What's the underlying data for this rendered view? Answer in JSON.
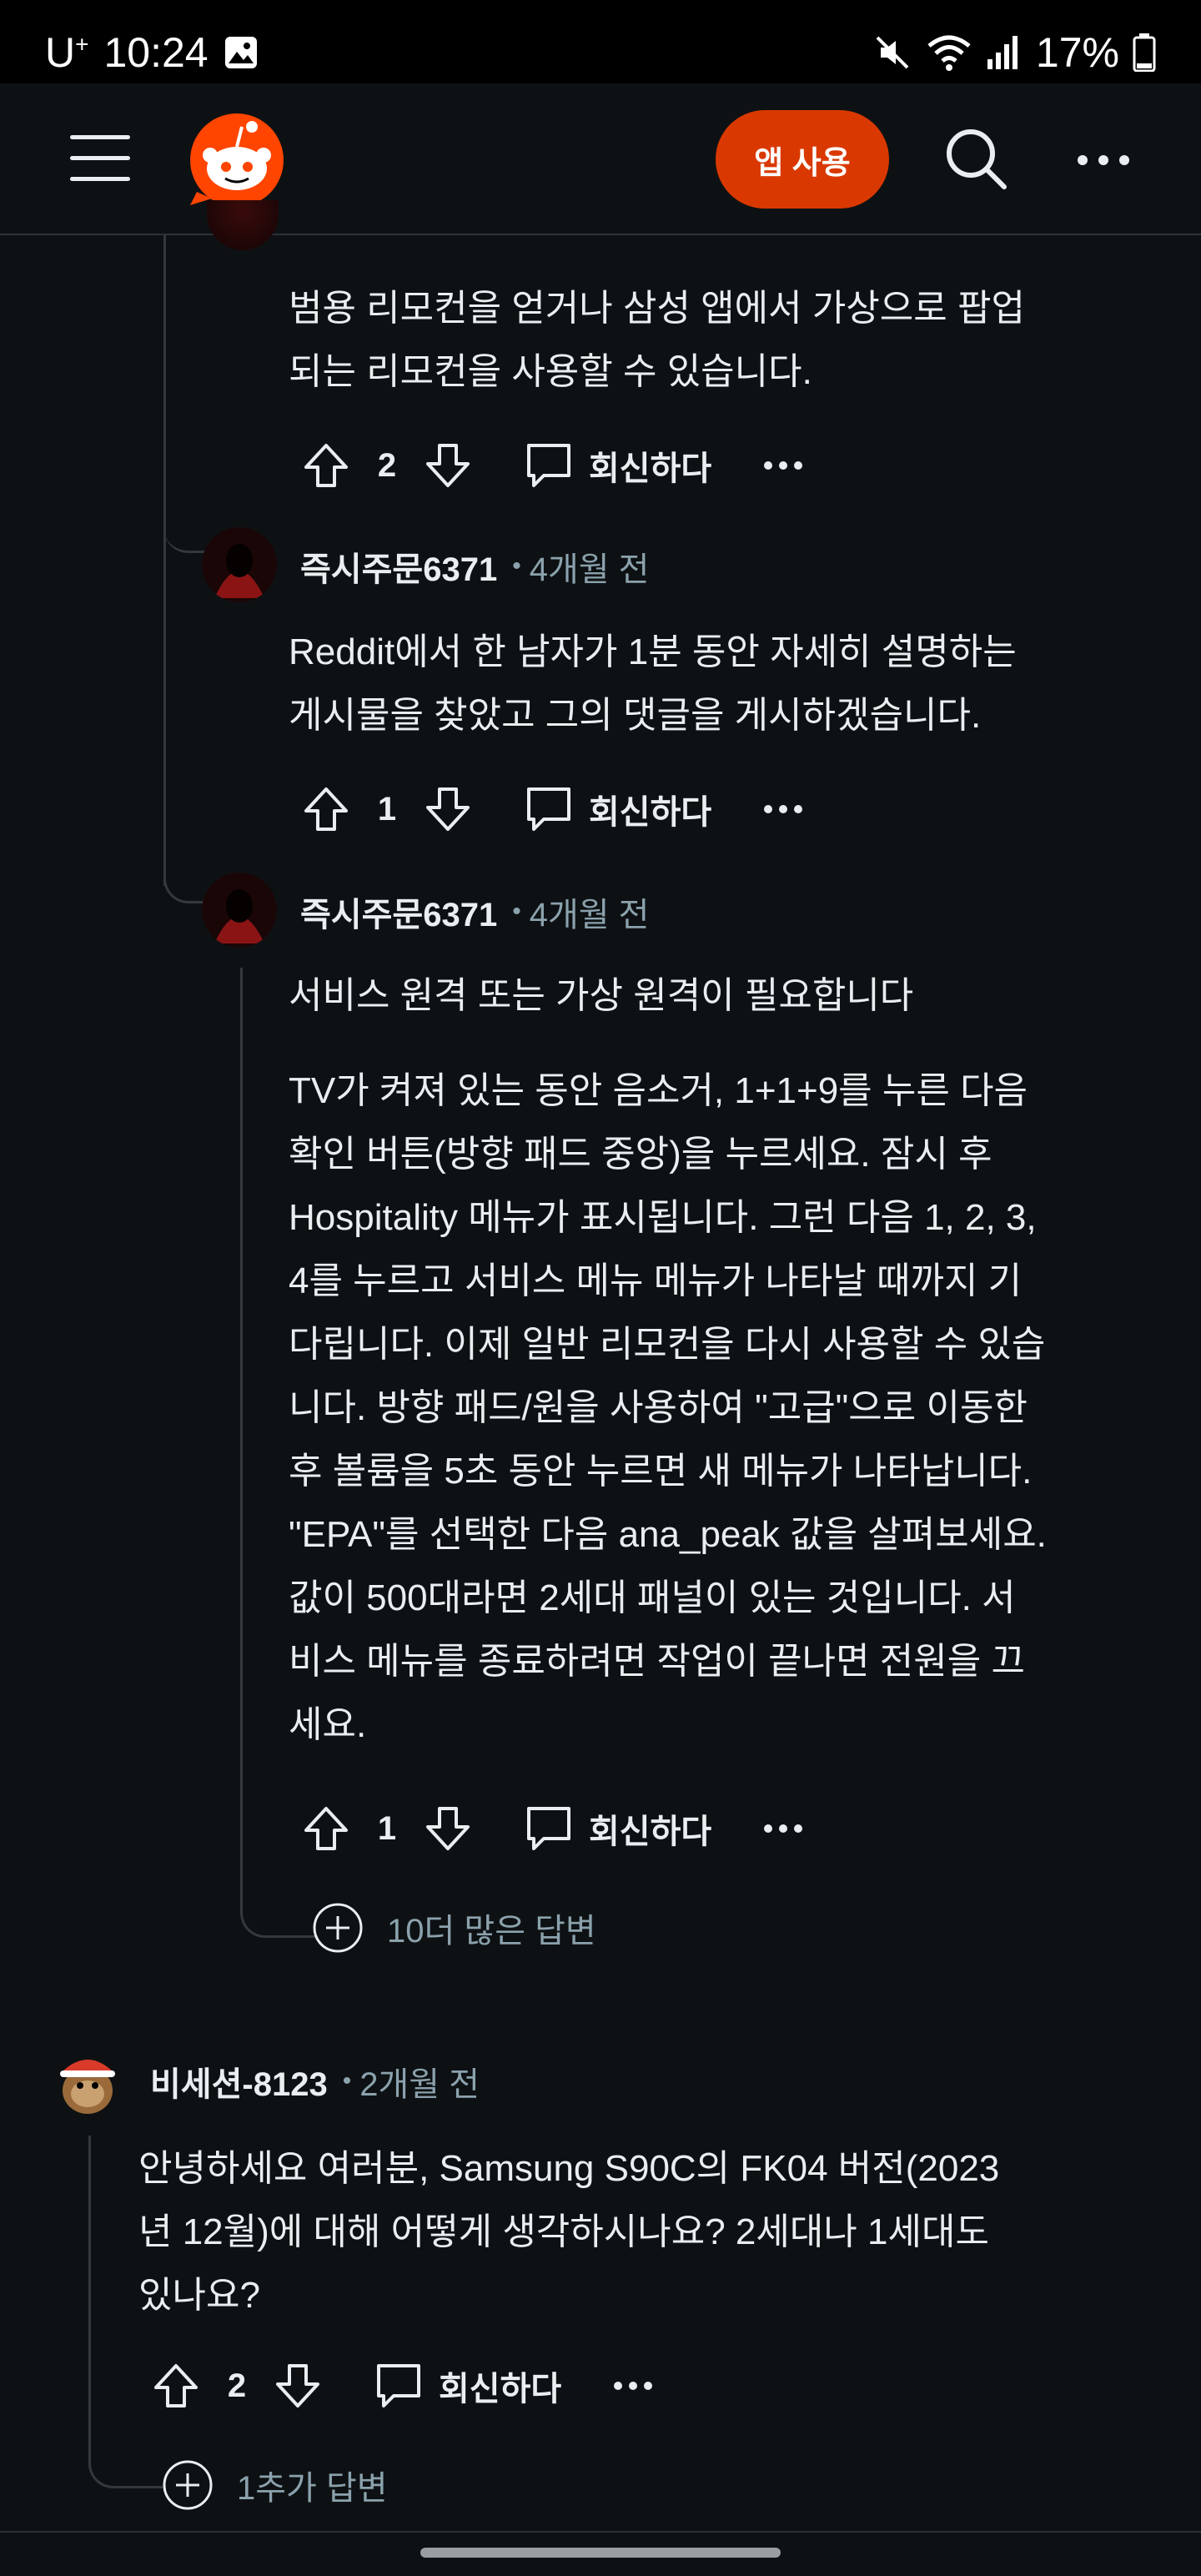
{
  "status_bar": {
    "carrier": "U",
    "carrier_sup": "+",
    "time": "10:24",
    "battery": "17%"
  },
  "app_bar": {
    "open_app_label": "앱 사용"
  },
  "comments": [
    {
      "body": [
        "범용 리모컨을 얻거나 삼성 앱에서 가상으로 팝업",
        "되는 리모컨을 사용할 수 있습니다."
      ],
      "votes": "2",
      "reply_label": "회신하다"
    },
    {
      "username": "즉시주문6371",
      "age": "4개월 전",
      "body": [
        "Reddit에서 한 남자가 1분 동안 자세히 설명하는",
        "게시물을 찾았고 그의 댓글을 게시하겠습니다."
      ],
      "votes": "1",
      "reply_label": "회신하다"
    },
    {
      "username": "즉시주문6371",
      "age": "4개월 전",
      "body": [
        "서비스 원격 또는 가상 원격이 필요합니다",
        "",
        "TV가 켜져 있는 동안 음소거, 1+1+9를 누른 다음",
        "확인 버튼(방향 패드 중앙)을 누르세요. 잠시 후",
        "Hospitality 메뉴가 표시됩니다. 그런 다음 1, 2, 3,",
        "4를 누르고 서비스 메뉴 메뉴가 나타날 때까지 기",
        "다립니다. 이제 일반 리모컨을 다시 사용할 수 있습",
        "니다. 방향 패드/원을 사용하여 \"고급\"으로 이동한",
        "후 볼륨을 5초 동안 누르면 새 메뉴가 나타납니다.",
        "\"EPA\"를 선택한 다음 ana_peak 값을 살펴보세요.",
        "값이 500대라면 2세대 패널이 있는 것입니다. 서",
        "비스 메뉴를 종료하려면 작업이 끝나면 전원을 끄",
        "세요."
      ],
      "votes": "1",
      "reply_label": "회신하다",
      "more_replies": "10더 많은 답변"
    },
    {
      "username": "비세션-8123",
      "age": "2개월 전",
      "body": [
        "안녕하세요 여러분, Samsung S90C의 FK04 버전(2023",
        "년 12월)에 대해 어떻게 생각하시나요? 2세대나 1세대도",
        "있나요?"
      ],
      "votes": "2",
      "reply_label": "회신하다",
      "more_replies": "1추가 답변"
    }
  ],
  "colors": {
    "background": "#0e1113",
    "accent": "#d93900",
    "muted": "#8ba2ad"
  }
}
